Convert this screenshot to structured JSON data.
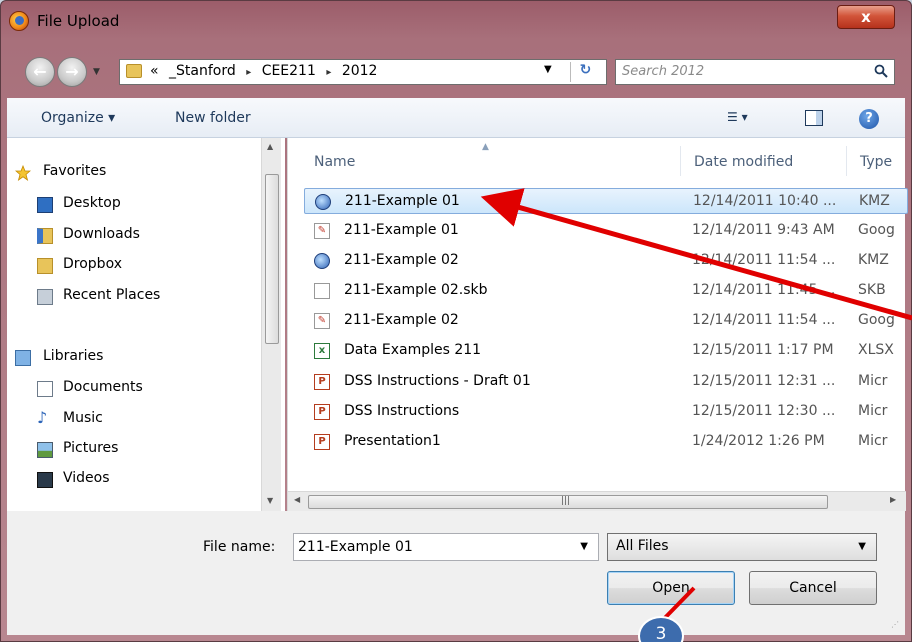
{
  "window": {
    "title": "File Upload",
    "close_label": "x"
  },
  "address": {
    "overflow": "«",
    "crumbs": [
      "_Stanford",
      "CEE211",
      "2012"
    ],
    "separator": "▸"
  },
  "search": {
    "placeholder": "Search 2012"
  },
  "toolbar": {
    "organize": "Organize ▾",
    "new_folder": "New folder",
    "view_symbol": "▾",
    "help_symbol": "?"
  },
  "nav": {
    "favorites": "Favorites",
    "favorite_items": [
      "Desktop",
      "Downloads",
      "Dropbox",
      "Recent Places"
    ],
    "libraries": "Libraries",
    "library_items": [
      "Documents",
      "Music",
      "Pictures",
      "Videos"
    ]
  },
  "columns": {
    "name": "Name",
    "date": "Date modified",
    "type": "Type"
  },
  "files": [
    {
      "name": "211-Example 01",
      "date": "12/14/2011 10:40 ...",
      "type": "KMZ",
      "icon": "google-earth-icon",
      "selected": true
    },
    {
      "name": "211-Example 01",
      "date": "12/14/2011 9:43 AM",
      "type": "Goog",
      "icon": "sketchup-icon"
    },
    {
      "name": "211-Example 02",
      "date": "12/14/2011 11:54 ...",
      "type": "KMZ",
      "icon": "google-earth-icon"
    },
    {
      "name": "211-Example 02.skb",
      "date": "12/14/2011 11:45 ...",
      "type": "SKB",
      "icon": "blank-file-icon"
    },
    {
      "name": "211-Example 02",
      "date": "12/14/2011 11:54 ...",
      "type": "Goog",
      "icon": "sketchup-icon"
    },
    {
      "name": "Data Examples 211",
      "date": "12/15/2011 1:17 PM",
      "type": "XLSX",
      "icon": "excel-icon"
    },
    {
      "name": "DSS Instructions - Draft 01",
      "date": "12/15/2011 12:31 ...",
      "type": "Micr",
      "icon": "powerpoint-icon"
    },
    {
      "name": "DSS Instructions",
      "date": "12/15/2011 12:30 ...",
      "type": "Micr",
      "icon": "powerpoint-icon"
    },
    {
      "name": "Presentation1",
      "date": "1/24/2012 1:26 PM",
      "type": "Micr",
      "icon": "powerpoint-icon"
    }
  ],
  "bottom": {
    "file_name_label": "File name:",
    "file_name_value": "211-Example 01",
    "file_type": "All Files",
    "open": "Open",
    "cancel": "Cancel"
  },
  "annotation": {
    "step": "3",
    "arrow_color": "#e00000"
  }
}
